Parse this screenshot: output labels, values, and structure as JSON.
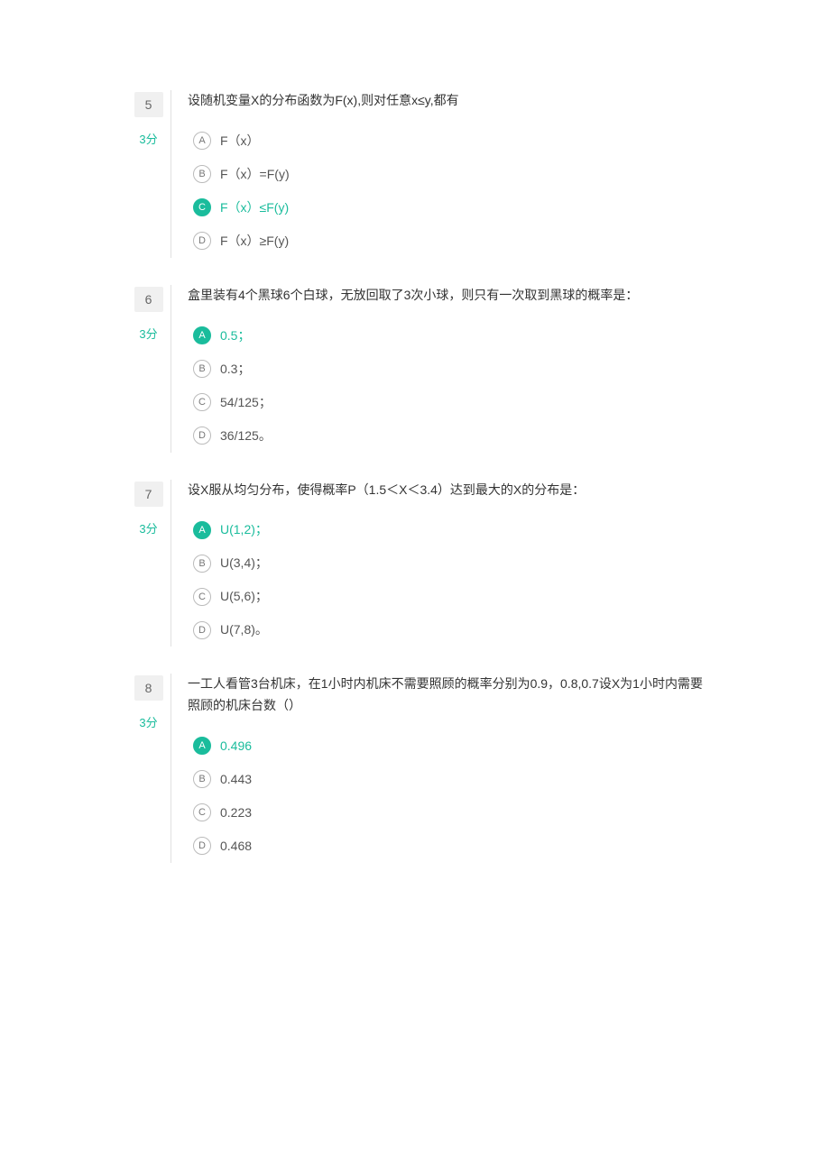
{
  "questions": [
    {
      "num": "5",
      "score": "3分",
      "stem": "设随机变量X的分布函数为F(x),则对任意x≤y,都有",
      "options": [
        {
          "letter": "A",
          "text": "F（x）",
          "selected": false
        },
        {
          "letter": "B",
          "text": "F（x）=F(y)",
          "selected": false
        },
        {
          "letter": "C",
          "text": "F（x）≤F(y)",
          "selected": true
        },
        {
          "letter": "D",
          "text": "F（x）≥F(y)",
          "selected": false
        }
      ]
    },
    {
      "num": "6",
      "score": "3分",
      "stem": "盒里装有4个黑球6个白球，无放回取了3次小球，则只有一次取到黑球的概率是：",
      "options": [
        {
          "letter": "A",
          "text": "0.5；",
          "selected": true
        },
        {
          "letter": "B",
          "text": "0.3；",
          "selected": false
        },
        {
          "letter": "C",
          "text": "54/125；",
          "selected": false
        },
        {
          "letter": "D",
          "text": "36/125。",
          "selected": false
        }
      ]
    },
    {
      "num": "7",
      "score": "3分",
      "stem": "设X服从均匀分布，使得概率P（1.5＜X＜3.4）达到最大的X的分布是：",
      "options": [
        {
          "letter": "A",
          "text": "U(1,2)；",
          "selected": true
        },
        {
          "letter": "B",
          "text": "U(3,4)；",
          "selected": false
        },
        {
          "letter": "C",
          "text": "U(5,6)；",
          "selected": false
        },
        {
          "letter": "D",
          "text": "U(7,8)。",
          "selected": false
        }
      ]
    },
    {
      "num": "8",
      "score": "3分",
      "stem": "一工人看管3台机床，在1小时内机床不需要照顾的概率分别为0.9，0.8,0.7设X为1小时内需要照顾的机床台数（）",
      "options": [
        {
          "letter": "A",
          "text": "0.496",
          "selected": true
        },
        {
          "letter": "B",
          "text": "0.443",
          "selected": false
        },
        {
          "letter": "C",
          "text": "0.223",
          "selected": false
        },
        {
          "letter": "D",
          "text": "0.468",
          "selected": false
        }
      ]
    }
  ]
}
